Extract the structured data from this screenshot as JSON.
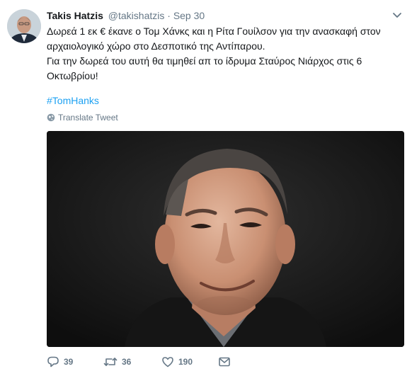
{
  "tweet": {
    "author_name": "Takis Hatzis",
    "handle": "@takishatzis",
    "separator": "·",
    "time": "Sep 30",
    "text_line1": "Δωρεά 1 εκ € έκανε ο Τομ Χάνκς και η Ρίτα Γουίλσον για την ανασκαφή στον αρχαιολογικό χώρο στο Δεσποτικό της Αντίπαρου.",
    "text_line2": "Για την δωρεά του αυτή θα τιμηθεί απ το ίδρυμα Σταύρος Νιάρχος στις 6 Οκτωβρίου!",
    "hashtag": "#TomHanks",
    "translate_label": "Translate Tweet"
  },
  "actions": {
    "replies": "39",
    "retweets": "36",
    "likes": "190"
  },
  "colors": {
    "link": "#1da1f2",
    "secondary_text": "#657786",
    "primary_text": "#14171a"
  },
  "icons": {
    "reply": "reply-icon",
    "retweet": "retweet-icon",
    "like": "heart-icon",
    "message": "envelope-icon",
    "menu": "chevron-down-icon",
    "translate": "globe-icon"
  }
}
